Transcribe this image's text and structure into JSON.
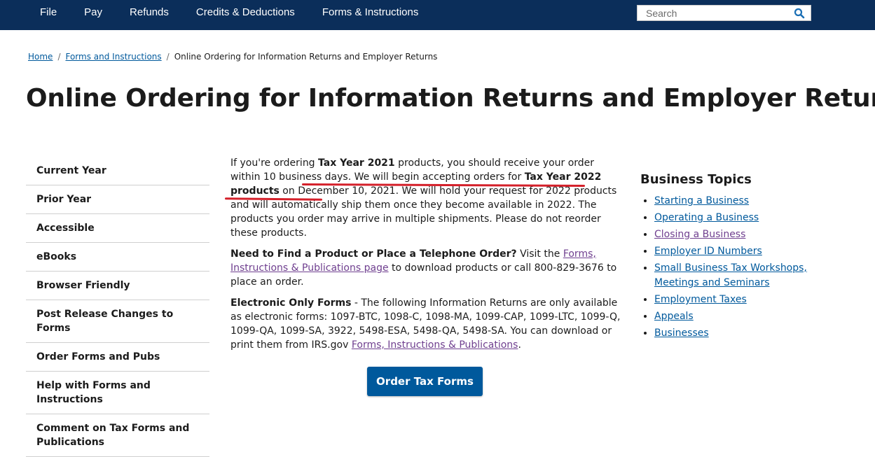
{
  "topnav": {
    "items": [
      "File",
      "Pay",
      "Refunds",
      "Credits & Deductions",
      "Forms & Instructions"
    ],
    "search_placeholder": "Search"
  },
  "breadcrumb": {
    "home": "Home",
    "forms": "Forms and Instructions",
    "current": "Online Ordering for Information Returns and Employer Returns"
  },
  "page": {
    "title": "Online Ordering for Information Returns and Employer Returns"
  },
  "sidebar": {
    "items": [
      "Current Year",
      "Prior Year",
      "Accessible",
      "eBooks",
      "Browser Friendly",
      "Post Release Changes to Forms",
      "Order Forms and Pubs",
      "Help with Forms and Instructions",
      "Comment on Tax Forms and Publications"
    ]
  },
  "main": {
    "p1": {
      "a": "If you're ordering ",
      "b": "Tax Year 2021",
      "c": " products, you should receive your order within 10 business days. ",
      "d": "We will begin accepting orders for ",
      "e": "Tax Year 2022 products",
      "f": " on December 10, 2021",
      "g": ". We will hold your request for 2022 products and will automatically ship them once they become available in 2022. The products you order may arrive in multiple shipments. Please do not reorder these products."
    },
    "p2": {
      "bold": "Need to Find a Product or Place a Telephone Order?",
      "a": " Visit the ",
      "link": "Forms, Instructions & Publications page",
      "b": " to download products or call 800-829-3676 to place an order."
    },
    "p3": {
      "bold": "Electronic Only Forms",
      "a": " - The following Information Returns are only available as electronic forms: 1097-BTC, 1098-C, 1098-MA, 1099-CAP, 1099-LTC, 1099-Q, 1099-QA, 1099-SA, 3922, 5498-ESA, 5498-QA, 5498-SA.   You can download or print them from IRS.gov ",
      "link": "Forms, Instructions & Publications",
      "b": "."
    },
    "order_button": "Order Tax Forms"
  },
  "topics": {
    "title": "Business Topics",
    "items": [
      "Starting a Business",
      "Operating a Business",
      "Closing a Business",
      "Employer ID Numbers",
      "Small Business Tax Workshops, Meetings and Seminars",
      "Employment Taxes",
      "Appeals",
      "Businesses"
    ]
  },
  "colors": {
    "nav_bg": "#0b2e5a",
    "link": "#00599c",
    "visited_link": "#6f3f8f",
    "annotation": "#d4202a",
    "button": "#00599c"
  }
}
